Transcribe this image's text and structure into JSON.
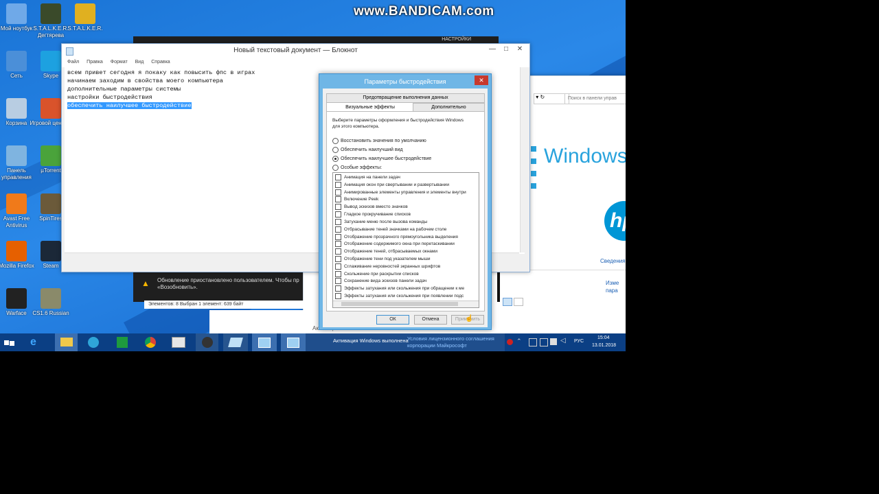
{
  "watermark": "www.BANDICAM.com",
  "desktop_icons": [
    {
      "label": "Мой ноутбук",
      "icon": "computer-icon",
      "color": "#6fa9e8"
    },
    {
      "label": "S.T.A.L.K.E.R. Дегтярева",
      "icon": "stalker-icon",
      "color": "#3a4a2a"
    },
    {
      "label": "S.T.A.L.K.E.R.",
      "icon": "radiation-icon",
      "color": "#e0b020"
    },
    {
      "label": "Сеть",
      "icon": "network-icon",
      "color": "#4b8fd8"
    },
    {
      "label": "Skype",
      "icon": "skype-icon",
      "color": "#1da1e0"
    },
    {
      "label": "Корзина",
      "icon": "recycle-bin-icon",
      "color": "#b8cde2"
    },
    {
      "label": "Игровой центр...",
      "icon": "game-center-icon",
      "color": "#d9532b"
    },
    {
      "label": "Панель управления",
      "icon": "control-panel-icon",
      "color": "#7fb4e0"
    },
    {
      "label": "µTorrent",
      "icon": "utorrent-icon",
      "color": "#4aa33b"
    },
    {
      "label": "Avast Free Antivirus",
      "icon": "avast-icon",
      "color": "#f07a1a"
    },
    {
      "label": "SpinTires",
      "icon": "spintires-icon",
      "color": "#6b5a3a"
    },
    {
      "label": "Mozilla Firefox",
      "icon": "firefox-icon",
      "color": "#e66000"
    },
    {
      "label": "Steam",
      "icon": "steam-icon",
      "color": "#1b2838"
    },
    {
      "label": "Warface",
      "icon": "warface-icon",
      "color": "#222"
    },
    {
      "label": "CS1.6 Russian",
      "icon": "cs-icon",
      "color": "#8a8a6a"
    }
  ],
  "notepad": {
    "title": "Новый текстовый документ — Блокнот",
    "menu": [
      "Файл",
      "Правка",
      "Формат",
      "Вид",
      "Справка"
    ],
    "lines": [
      "всем привет сегодня я покаку как повысить фпс в играх",
      "начинаем заходим в свойства моего компьютера",
      "дополнительные параметры системы",
      "настройки быстродействия"
    ],
    "selected_line": "обеспечить наилучшее быстродействие"
  },
  "bg_window": {
    "top_label": "НАСТРОЙКИ",
    "search_placeholder": "Поиск в панели управ",
    "windows_logo_text": "Windows",
    "hp_link": "Сведения",
    "change_link": "Изме пара",
    "notification": "Обновление приостановлено пользователем. Чтобы пр «Возобновить».",
    "status_bar": "Элементов: 8    Выбран 1 элемент: 639 байт"
  },
  "dialog": {
    "title": "Параметры быстродействия",
    "tab_top": "Предотвращение выполнения данных",
    "tab_visual": "Визуальные эффекты",
    "tab_advanced": "Дополнительно",
    "description": "Выберите параметры оформления и быстродействия Windows для этого компьютера.",
    "radios": [
      {
        "label": "Восстановить значения по умолчанию",
        "checked": false
      },
      {
        "label": "Обеспечить наилучший вид",
        "checked": false
      },
      {
        "label": "Обеспечить наилучшее быстродействие",
        "checked": true
      },
      {
        "label": "Особые эффекты:",
        "checked": false
      }
    ],
    "effects": [
      "Анимация на панели задач",
      "Анимация окон при свертывании и развертывании",
      "Анимированные элементы управления и элементы внутри",
      "Включение Peek",
      "Вывод эскизов вместо значков",
      "Гладкое прокручивание списков",
      "Затухание меню после вызова команды",
      "Отбрасывание теней значками на рабочем столе",
      "Отображение прозрачного прямоугольника выделения",
      "Отображение содержимого окна при перетаскивании",
      "Отображение теней, отбрасываемых окнами",
      "Отображение тени под указателем мыши",
      "Сглаживание неровностей экранных шрифтов",
      "Скольжение при раскрытии списков",
      "Сохранение вида эскизов панели задач",
      "Эффекты затухания или скольжения при обращении к ме",
      "Эффекты затухания или скольжения при появлении подс"
    ],
    "ok": "ОК",
    "cancel": "Отмена",
    "apply": "Применить"
  },
  "taskbar": {
    "activation_label": "Активация Windows выполнена",
    "activation_link": "Условия лицензионного соглашения корпорации Майкрософт",
    "behind_text": "Активация Windows",
    "language": "РУС",
    "time": "15:04",
    "date": "13.01.2018"
  }
}
